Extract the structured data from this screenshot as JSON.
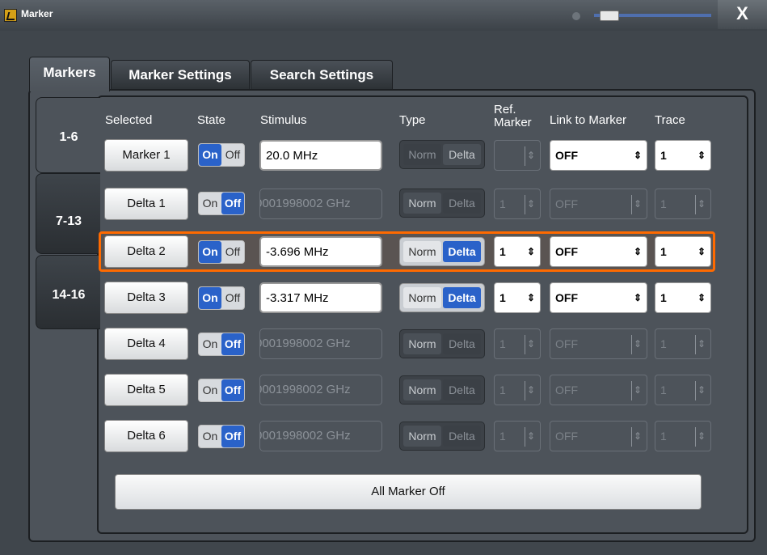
{
  "window": {
    "title": "Marker",
    "close_label": "X"
  },
  "tabs": [
    "Markers",
    "Marker Settings",
    "Search Settings"
  ],
  "side_tabs": [
    "1-6",
    "7-13",
    "14-16"
  ],
  "headers": {
    "selected": "Selected",
    "state": "State",
    "stimulus": "Stimulus",
    "type": "Type",
    "ref_marker_line1": "Ref.",
    "ref_marker_line2": "Marker",
    "link_to_marker": "Link to Marker",
    "trace": "Trace"
  },
  "toggle_labels": {
    "on": "On",
    "off": "Off"
  },
  "type_labels": {
    "norm": "Norm",
    "delta": "Delta"
  },
  "rows": [
    {
      "selected": "Marker 1",
      "state": "On",
      "stimulus": "20.0 MHz",
      "type": "Norm",
      "ref": "",
      "link": "OFF",
      "trace": "1",
      "enabled": true
    },
    {
      "selected": "Delta 1",
      "state": "Off",
      "stimulus": "0001998002 GHz",
      "type": "Norm",
      "ref": "1",
      "link": "OFF",
      "trace": "1",
      "enabled": false
    },
    {
      "selected": "Delta 2",
      "state": "On",
      "stimulus": "-3.696 MHz",
      "type": "Delta",
      "ref": "1",
      "link": "OFF",
      "trace": "1",
      "enabled": true,
      "highlighted": true
    },
    {
      "selected": "Delta 3",
      "state": "On",
      "stimulus": "-3.317 MHz",
      "type": "Delta",
      "ref": "1",
      "link": "OFF",
      "trace": "1",
      "enabled": true
    },
    {
      "selected": "Delta 4",
      "state": "Off",
      "stimulus": "0001998002 GHz",
      "type": "Norm",
      "ref": "1",
      "link": "OFF",
      "trace": "1",
      "enabled": false
    },
    {
      "selected": "Delta 5",
      "state": "Off",
      "stimulus": "0001998002 GHz",
      "type": "Norm",
      "ref": "1",
      "link": "OFF",
      "trace": "1",
      "enabled": false
    },
    {
      "selected": "Delta 6",
      "state": "Off",
      "stimulus": "0001998002 GHz",
      "type": "Norm",
      "ref": "1",
      "link": "OFF",
      "trace": "1",
      "enabled": false
    }
  ],
  "all_marker_off_label": "All Marker Off",
  "colors": {
    "highlight": "#ff6a00",
    "accent": "#2a62c9",
    "panel": "#4d535a"
  }
}
